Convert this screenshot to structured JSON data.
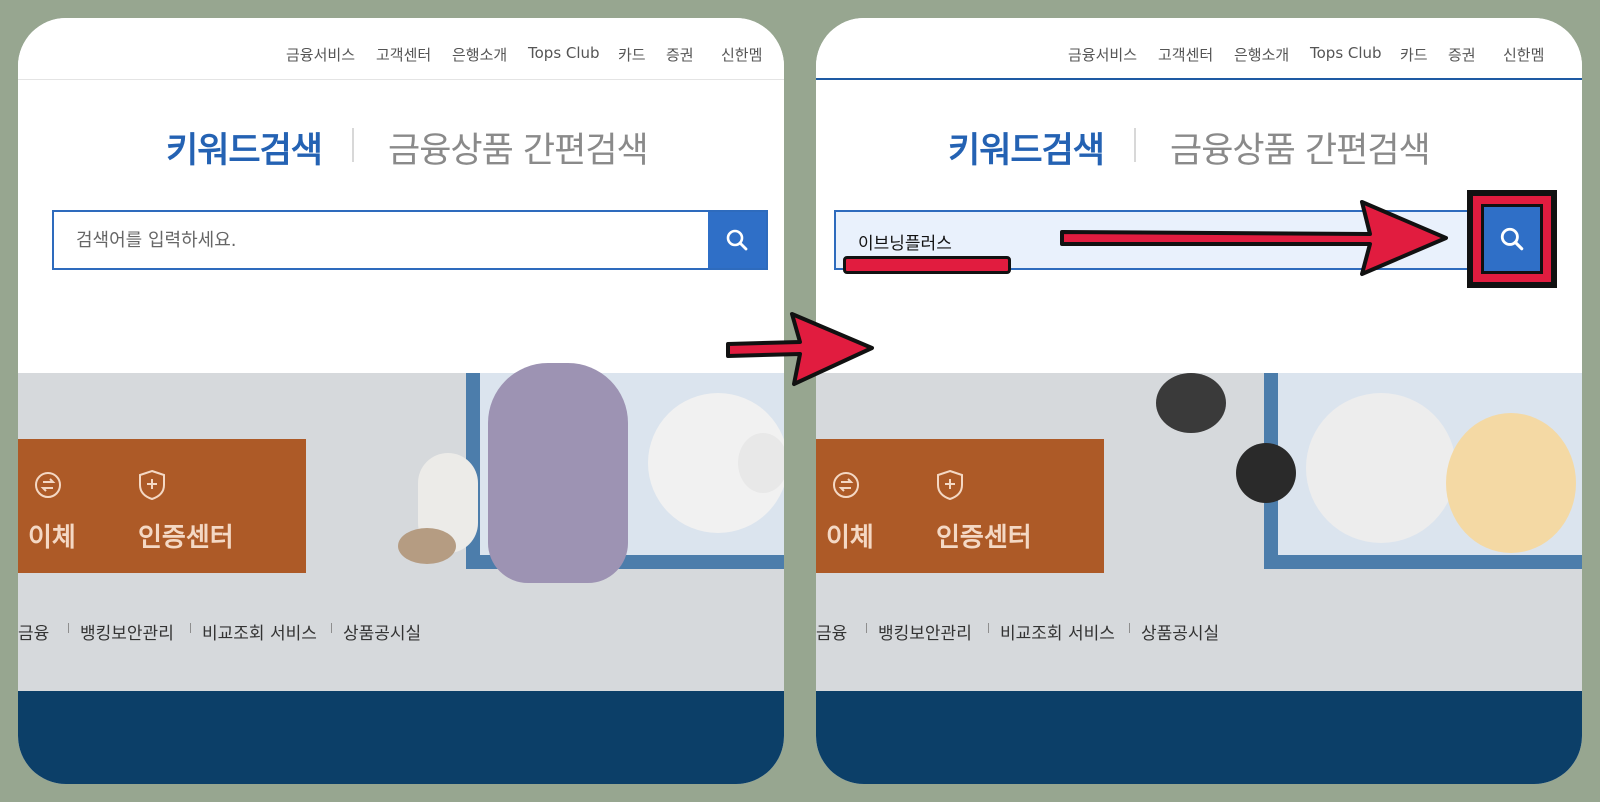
{
  "nav": {
    "items": [
      "금융서비스",
      "고객센터",
      "은행소개",
      "Tops Club",
      "카드",
      "증권",
      "신한멤"
    ]
  },
  "tabs": {
    "keyword": "키워드검색",
    "product": "금융상품 간편검색"
  },
  "search": {
    "placeholder": "검색어를 입력하세요.",
    "value_after": "이브닝플러스"
  },
  "hero": {
    "card_items": [
      "이체",
      "인증센터"
    ],
    "links": [
      "금융",
      "뱅킹보안관리",
      "비교조회 서비스",
      "상품공시실"
    ]
  },
  "colors": {
    "background": "#97a690",
    "accent_blue": "#2f6fc7",
    "annotation_red": "#e11c3f",
    "footer_navy": "#0c3f68",
    "card_orange": "#ad5a27"
  },
  "icons": [
    "search-icon",
    "transfer-icon",
    "certificate-icon",
    "arrow-icon"
  ]
}
